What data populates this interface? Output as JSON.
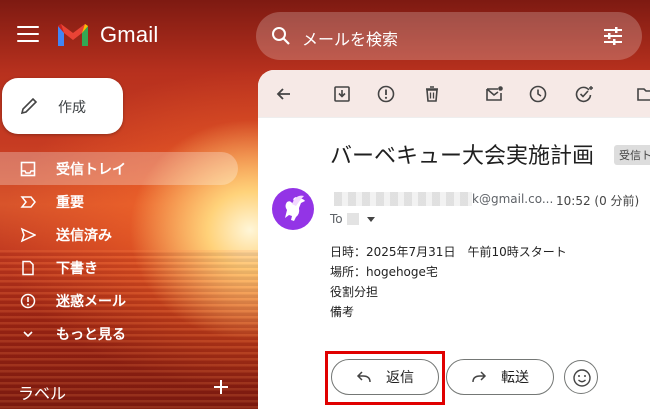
{
  "app": {
    "name": "Gmail"
  },
  "search": {
    "placeholder": "メールを検索"
  },
  "compose": {
    "label": "作成"
  },
  "nav": {
    "items": [
      {
        "label": "受信トレイ",
        "icon": "inbox-icon",
        "active": true
      },
      {
        "label": "重要",
        "icon": "label-important-icon"
      },
      {
        "label": "送信済み",
        "icon": "send-icon"
      },
      {
        "label": "下書き",
        "icon": "draft-icon"
      },
      {
        "label": "迷惑メール",
        "icon": "spam-icon"
      },
      {
        "label": "もっと見る",
        "icon": "chevron-down-icon"
      }
    ],
    "labels_header": "ラベル"
  },
  "email": {
    "subject": "バーベキュー大会実施計画",
    "folder_chip": "受信ト",
    "sender_email_suffix": "k@gmail.co...",
    "time": "10:52 (0 分前)",
    "to_label": "To",
    "body": [
      "日時：2025年7月31日　午前10時スタート",
      "場所：hogehoge宅",
      "役割分担",
      "備考"
    ]
  },
  "actions": {
    "reply": "返信",
    "forward": "転送"
  },
  "colors": {
    "highlight": "#e00000",
    "avatar_bg": "#9334e6"
  }
}
